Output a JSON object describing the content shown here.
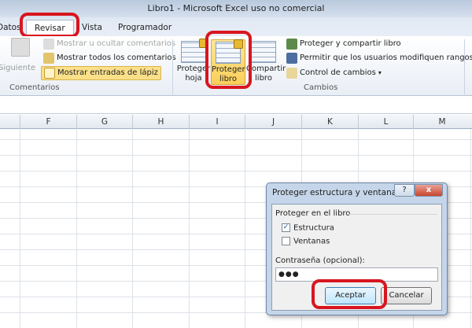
{
  "window": {
    "title": "Libro1  -  Microsoft Excel uso no comercial"
  },
  "tabs": [
    "Datos",
    "Revisar",
    "Vista",
    "Programador"
  ],
  "ribbon": {
    "comentarios": {
      "siguiente": "Siguiente",
      "mostrar_ocultar": "Mostrar u ocultar comentarios",
      "mostrar_todos": "Mostrar todos los comentarios",
      "entradas_lapiz": "Mostrar entradas de lápiz",
      "group": "Comentarios"
    },
    "cambios": {
      "proteger_hoja": [
        "Proteger",
        "hoja"
      ],
      "proteger_libro": [
        "Proteger",
        "libro"
      ],
      "compartir_libro": [
        "Compartir",
        "libro"
      ],
      "proteger_compartir": "Proteger y compartir libro",
      "permitir_rangos": "Permitir que los usuarios modifiquen rangos",
      "control_cambios": "Control de cambios",
      "dropdown": "▾",
      "group": "Cambios"
    }
  },
  "columns": [
    "F",
    "G",
    "H",
    "I",
    "J",
    "K",
    "L",
    "M"
  ],
  "dialog": {
    "title": "Proteger estructura y ventanas",
    "help": "?",
    "close": "x",
    "section": "Proteger en el libro",
    "estructura": {
      "label": "Estructura",
      "checked": true,
      "mark": "✓"
    },
    "ventanas": {
      "label": "Ventanas",
      "checked": false
    },
    "password_label": "Contraseña (opcional):",
    "password_value": "●●●",
    "ok": "Aceptar",
    "cancel": "Cancelar"
  }
}
